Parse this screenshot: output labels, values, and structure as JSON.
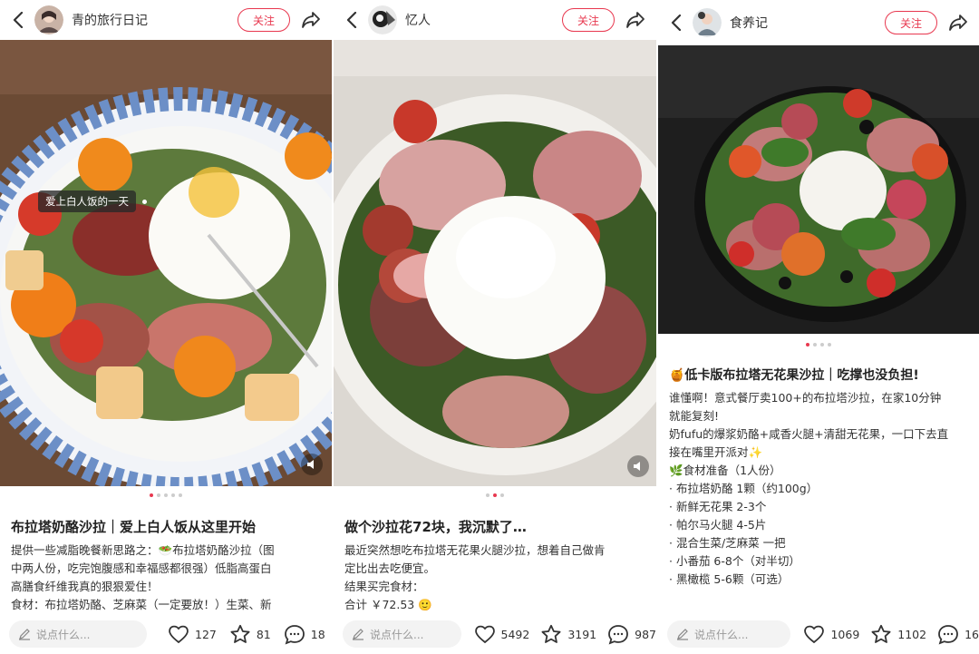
{
  "panels": [
    {
      "author": "青的旅行日记",
      "follow_label": "关注",
      "tooltip": "爱上白人饭的一天",
      "title": "布拉塔奶酪沙拉｜爱上白人饭从这里开始",
      "body": [
        "提供一些减脂晚餐新思路之：🥗布拉塔奶酪沙拉（图",
        "中两人份，吃完饱腹感和幸福感都很强）低脂高蛋白",
        "高膳食纤维我真的狠狠爱住！",
        "食材：布拉塔奶酪、芝麻菜（一定要放！）生菜、新"
      ],
      "comment_placeholder": "说点什么...",
      "likes": "127",
      "collects": "81",
      "comments": "18",
      "page_index": 1,
      "page_count": 5
    },
    {
      "author": "忆人",
      "follow_label": "关注",
      "title": "做个沙拉花72块，我沉默了…",
      "body": [
        "最近突然想吃布拉塔无花果火腿沙拉，想着自己做肯",
        "定比出去吃便宜。",
        "结果买完食材：",
        "合计 ￥72.53 🙂"
      ],
      "comment_placeholder": "说点什么...",
      "likes": "5492",
      "collects": "3191",
      "comments": "987",
      "page_index": 2,
      "page_count": 3
    },
    {
      "author": "食养记",
      "follow_label": "关注",
      "title": "🍯低卡版布拉塔无花果沙拉｜吃撑也没负担!",
      "body": [
        "谁懂啊！意式餐厅卖100+的布拉塔沙拉，在家10分钟",
        "就能复刻!",
        "奶fufu的爆浆奶酪+咸香火腿+清甜无花果，一口下去直",
        "接在嘴里开派对✨",
        "",
        "🌿食材准备（1人份）",
        "· 布拉塔奶酪 1颗（约100g）",
        "· 新鲜无花果 2-3个",
        "· 帕尔马火腿 4-5片",
        "· 混合生菜/芝麻菜 一把",
        "· 小番茄 6-8个（对半切）",
        "· 黑橄榄 5-6颗（可选）"
      ],
      "comment_placeholder": "说点什么...",
      "likes": "1069",
      "collects": "1102",
      "comments": "16",
      "page_index": 1,
      "page_count": 4
    }
  ],
  "colors": {
    "accent": "#e8384f",
    "text": "#222222",
    "muted": "#999999"
  }
}
